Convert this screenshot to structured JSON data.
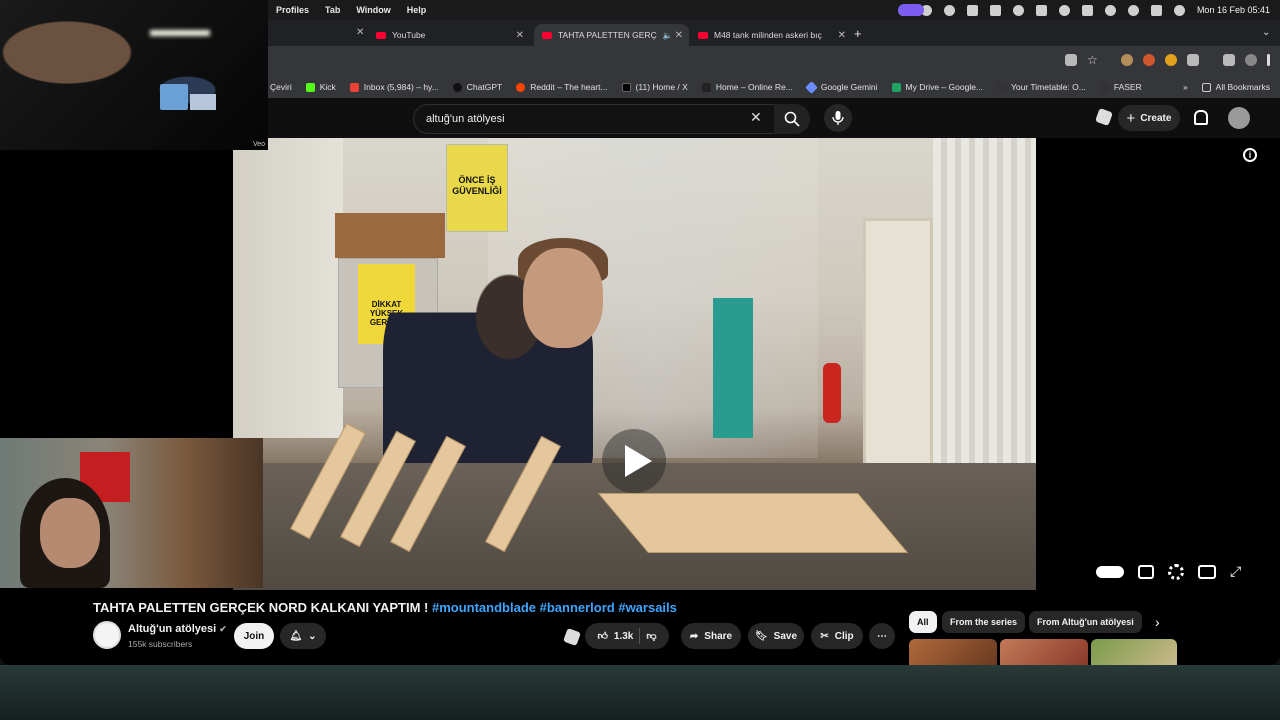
{
  "menubar": {
    "items": [
      "Profiles",
      "Tab",
      "Window",
      "Help"
    ],
    "datetime": "Mon 16 Feb  05:41"
  },
  "tabs": [
    {
      "label": "YouTube",
      "active": false
    },
    {
      "label": "TAHTA PALETTEN GERÇ",
      "active": true
    },
    {
      "label": "M48 tank milinden askeri bıç",
      "active": false
    }
  ],
  "bookmarks": {
    "items": [
      "Çeviri",
      "Kick",
      "Inbox (5,984) – hy...",
      "ChatGPT",
      "Reddit – The heart...",
      "(11) Home / X",
      "Home – Online Re...",
      "Google Gemini",
      "My Drive – Google...",
      "Your Timetable: O...",
      "FASER"
    ],
    "all_label": "All Bookmarks"
  },
  "youtube": {
    "search_value": "altuğ'un atölyesi",
    "create_label": "Create"
  },
  "video": {
    "poster_text": "ÖNCE İŞ GÜVENLİĞİ",
    "danger_text": "DİKKAT YÜKSEK GERİLİM",
    "watermark": "Veo"
  },
  "meta": {
    "title": "TAHTA PALETTEN GERÇEK NORD KALKANI YAPTIM !",
    "hashtags": "#mountandblade #bannerlord #warsails",
    "channel": "Altuğ'un atölyesi",
    "subscribers": "155k subscribers",
    "join_label": "Join",
    "like_count": "1.3k",
    "share_label": "Share",
    "save_label": "Save",
    "clip_label": "Clip"
  },
  "chips": [
    "All",
    "From the series",
    "From Altuğ'un atölyesi"
  ]
}
